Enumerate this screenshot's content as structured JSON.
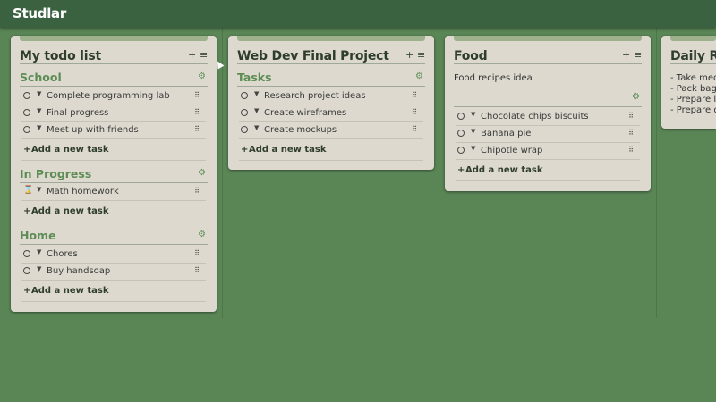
{
  "app": {
    "title": "Studlar"
  },
  "colors": {
    "background": "#5a8656",
    "topbar": "#3a6140",
    "card": "#ddd9ce",
    "section_title": "#5c8d55"
  },
  "icons": {
    "add": "+",
    "menu": "≡",
    "settings": "⚙",
    "caret": "▼",
    "grip": "⠿",
    "circle": "○",
    "in_progress": "⌛"
  },
  "boards": [
    {
      "title": "My todo list",
      "sections": [
        {
          "title": "School",
          "tasks": [
            "Complete programming lab",
            "Final progress",
            "Meet up with friends"
          ],
          "add_label": "Add a new task"
        },
        {
          "title": "In Progress",
          "tasks": [
            "Math homework"
          ],
          "add_label": "Add a new task"
        },
        {
          "title": "Home",
          "tasks": [
            "Chores",
            "Buy handsoap"
          ],
          "add_label": "Add a new task"
        }
      ]
    },
    {
      "title": "Web Dev Final Project",
      "sections": [
        {
          "title": "Tasks",
          "tasks": [
            "Research project ideas",
            "Create wireframes",
            "Create mockups"
          ],
          "add_label": "Add a new task"
        }
      ]
    },
    {
      "title": "Food",
      "note": "Food recipes idea",
      "sections": [
        {
          "title": "",
          "tasks": [
            "Chocolate chips biscuits",
            "Banana pie",
            "Chipotle wrap"
          ],
          "add_label": "Add a new task"
        }
      ]
    },
    {
      "title": "Daily Re",
      "lines": [
        "- Take meds",
        "- Pack bag f",
        "- Prepare lu",
        "- Prepare q"
      ]
    }
  ]
}
